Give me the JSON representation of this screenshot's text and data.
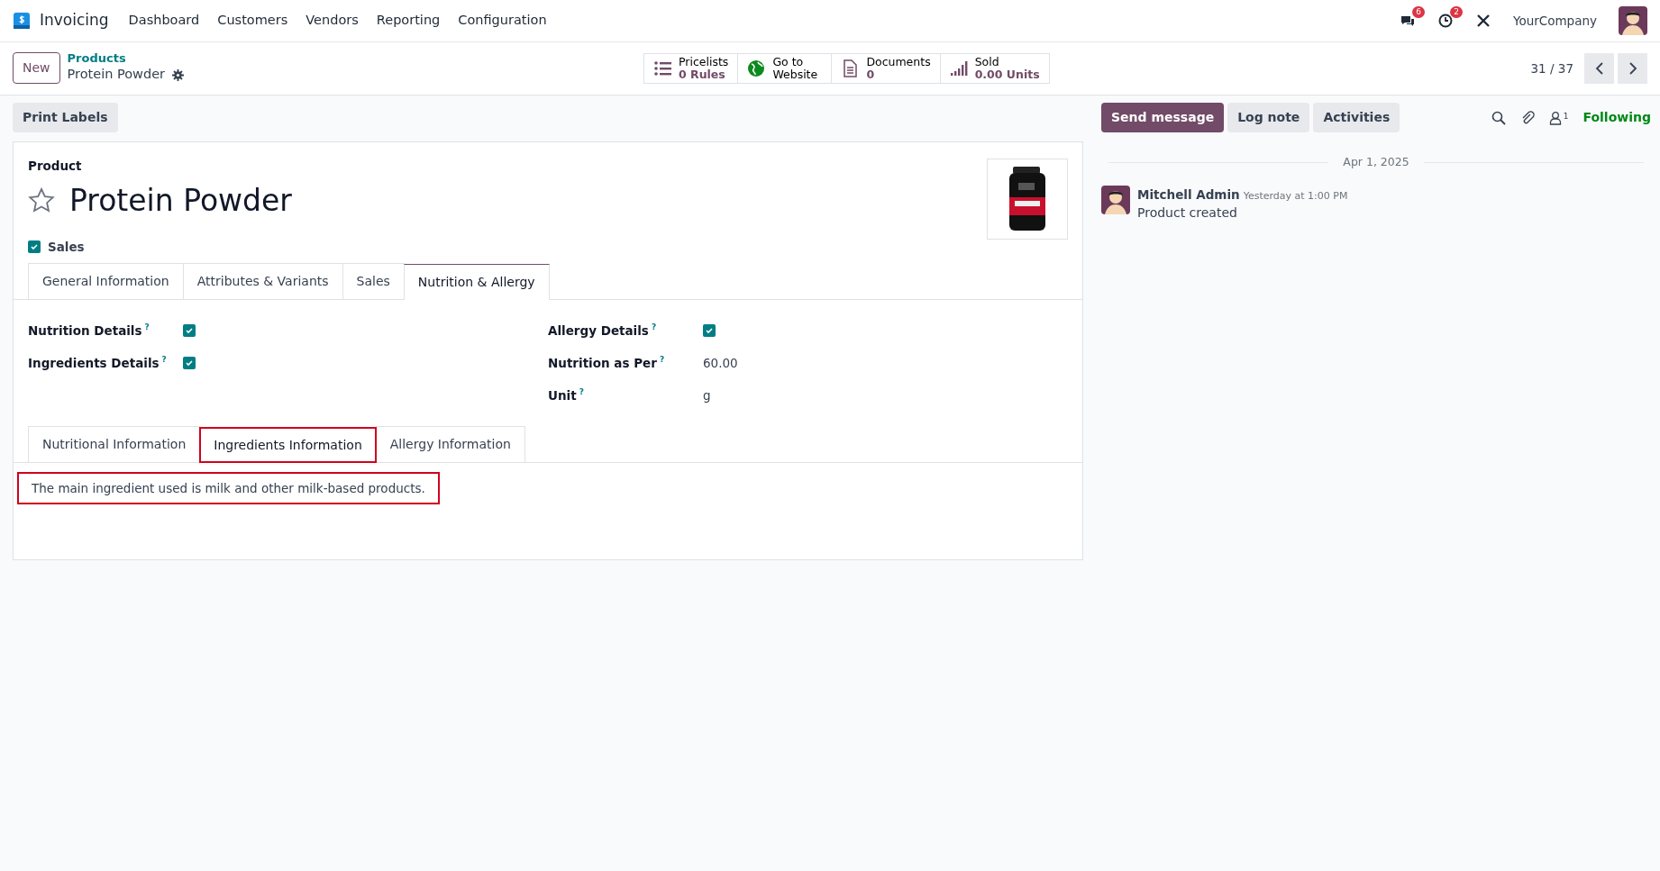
{
  "navbar": {
    "app_name": "Invoicing",
    "menu": [
      "Dashboard",
      "Customers",
      "Vendors",
      "Reporting",
      "Configuration"
    ],
    "messages_badge": "6",
    "activities_badge": "2",
    "company": "YourCompany"
  },
  "control_panel": {
    "new_button": "New",
    "breadcrumb": "Products",
    "record_name": "Protein Powder",
    "smart_buttons": [
      {
        "kind": "list",
        "label": "Pricelists",
        "value": "0 Rules"
      },
      {
        "kind": "globe",
        "label": "Go to",
        "value": "Website"
      },
      {
        "kind": "document",
        "label": "Documents",
        "value": "0"
      },
      {
        "kind": "bars",
        "label": "Sold",
        "value": "0.00 Units"
      }
    ],
    "pager": "31 / 37"
  },
  "action_buttons": [
    "Print Labels"
  ],
  "form": {
    "type_label": "Product",
    "name": "Protein Powder",
    "favorite": false,
    "options": [
      {
        "label": "Sales",
        "checked": true
      }
    ],
    "tabs": [
      {
        "label": "General Information",
        "selected": false
      },
      {
        "label": "Attributes & Variants",
        "selected": false
      },
      {
        "label": "Sales",
        "selected": false
      },
      {
        "label": "Nutrition & Allergy",
        "selected": true
      }
    ],
    "left_fields": [
      {
        "kind": "checkbox",
        "label": "Nutrition Details",
        "help": "?",
        "checked": true
      },
      {
        "kind": "checkbox",
        "label": "Ingredients Details",
        "help": "?",
        "checked": true
      }
    ],
    "right_fields": [
      {
        "kind": "checkbox",
        "label": "Allergy Details",
        "help": "?",
        "checked": true
      },
      {
        "kind": "text",
        "label": "Nutrition as Per",
        "help": "?",
        "value": "60.00"
      },
      {
        "kind": "text",
        "label": "Unit",
        "help": "?",
        "value": "g"
      }
    ],
    "sub_tabs": [
      {
        "label": "Nutritional Information",
        "selected": false,
        "highlighted": false
      },
      {
        "label": "Ingredients Information",
        "selected": true,
        "highlighted": true
      },
      {
        "label": "Allergy Information",
        "selected": false,
        "highlighted": false
      }
    ],
    "sub_tab_content": {
      "text": "The main ingredient used is milk and other milk-based products.",
      "highlighted": true
    }
  },
  "chatter": {
    "buttons": [
      {
        "label": "Send message",
        "primary": true
      },
      {
        "label": "Log note",
        "primary": false
      },
      {
        "label": "Activities",
        "primary": false
      }
    ],
    "followers_count": "1",
    "follow_status": "Following",
    "date_separator": "Apr 1, 2025",
    "messages": [
      {
        "author": "Mitchell Admin",
        "time": "Yesterday at 1:00 PM",
        "body": "Product created"
      }
    ]
  }
}
